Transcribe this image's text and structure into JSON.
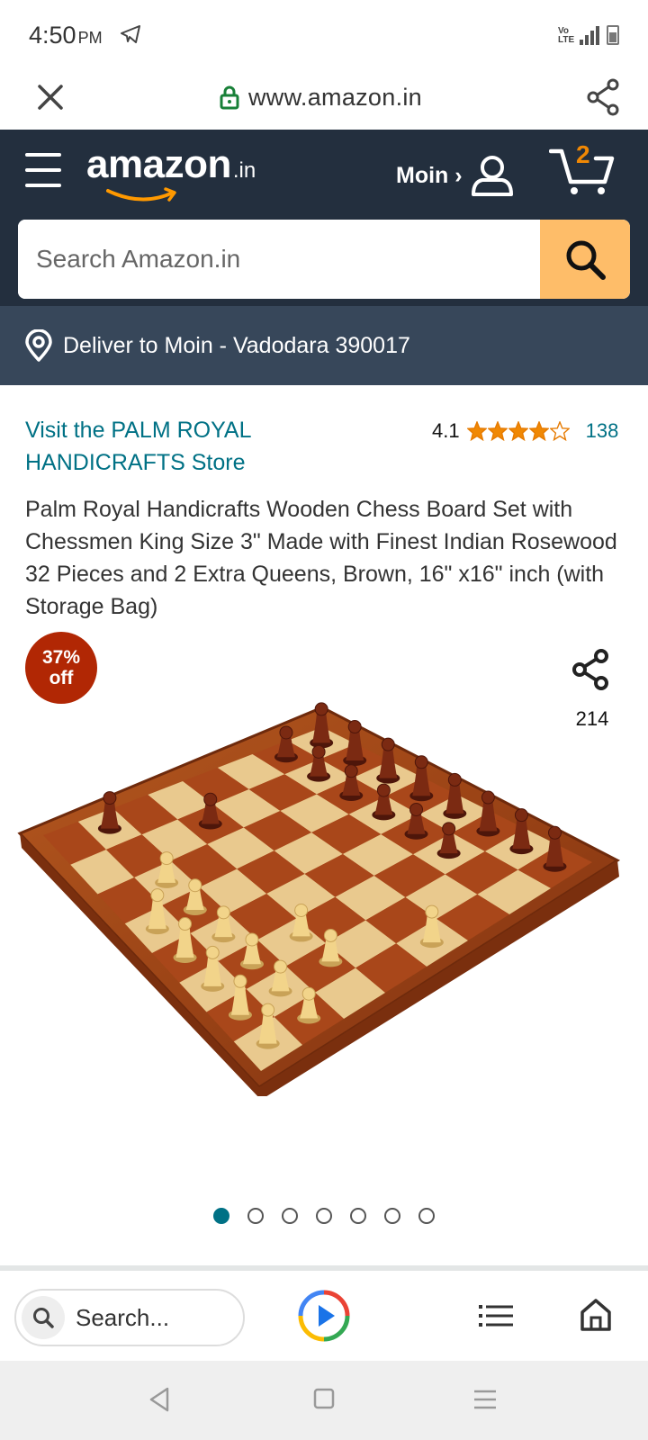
{
  "status_bar": {
    "time": "4:50",
    "ampm": "PM",
    "network": "LTE",
    "volte": "Vo LTE"
  },
  "browser": {
    "url": "www.amazon.in"
  },
  "header": {
    "logo_main": "amazon",
    "logo_tld": ".in",
    "account_name": "Moin ›",
    "cart_count": "2",
    "search_placeholder": "Search Amazon.in"
  },
  "deliver": {
    "text": "Deliver to Moin - Vadodara 390017"
  },
  "product": {
    "store_link": "Visit the PALM ROYAL HANDICRAFTS Store",
    "rating_value": "4.1",
    "rating_stars": 4.1,
    "rating_count": "138",
    "title": "Palm Royal Handicrafts Wooden Chess Board Set with Chessmen King Size 3\" Made with Finest Indian Rosewood 32 Pieces and 2 Extra Queens, Brown, 16\" x16\" inch (with Storage Bag)",
    "discount_pct": "37%",
    "discount_off": "off",
    "share_count": "214",
    "image_count": 7,
    "active_image": 1
  },
  "bottom_toolbar": {
    "search_text": "Search..."
  },
  "colors": {
    "header_bg": "#232f3e",
    "deliver_bg": "#37475a",
    "search_btn": "#febd69",
    "link": "#007185",
    "star": "#f08804",
    "discount": "#b12704"
  }
}
